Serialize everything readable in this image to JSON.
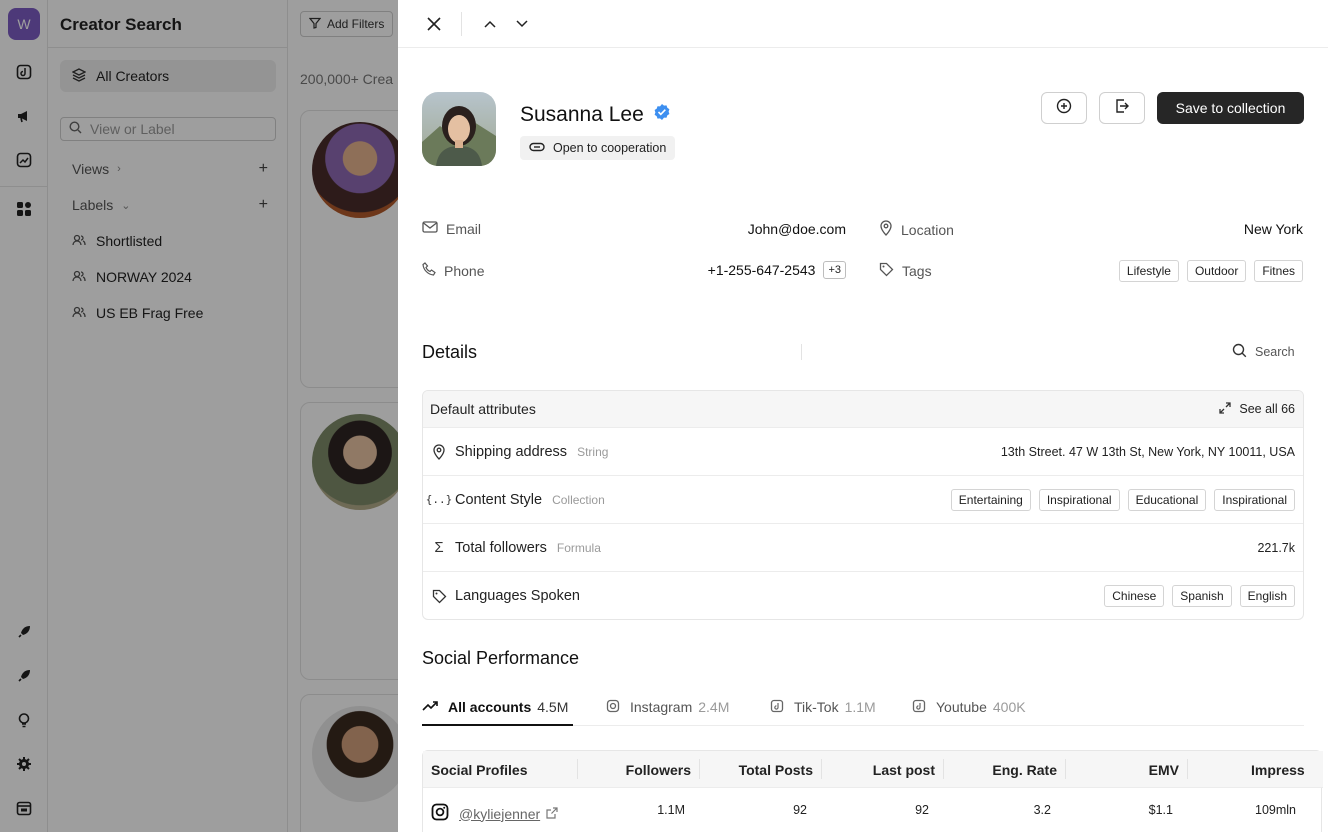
{
  "app": {
    "workspace_initial": "W",
    "title": "Creator Search",
    "add_filters_label": "Add Filters",
    "result_count": "200,000+ Crea"
  },
  "sidebar": {
    "all_creators": "All Creators",
    "search_placeholder": "View or Label",
    "views_label": "Views",
    "labels_label": "Labels",
    "labels": [
      "Shortlisted",
      "NORWAY 2024",
      "US EB Frag Free"
    ]
  },
  "profile": {
    "name": "Susanna Lee",
    "status": "Open to cooperation",
    "save_label": "Save to collection",
    "email_label": "Email",
    "email": "John@doe.com",
    "phone_label": "Phone",
    "phone": "+1-255-647-2543",
    "phone_extra": "+3",
    "location_label": "Location",
    "location": "New York",
    "tags_label": "Tags",
    "tags": [
      "Lifestyle",
      "Outdoor",
      "Fitnes"
    ]
  },
  "details": {
    "title": "Details",
    "search_label": "Search",
    "box_title": "Default attributes",
    "see_all": "See all 66",
    "rows": [
      {
        "name": "Shipping address",
        "type": "String",
        "value": "13th Street. 47 W 13th St, New York, NY 10011, USA"
      },
      {
        "name": "Content Style",
        "type": "Collection",
        "chips": [
          "Entertaining",
          "Inspirational",
          "Educational",
          "Inspirational"
        ]
      },
      {
        "name": "Total followers",
        "type": "Formula",
        "value": "221.7k"
      },
      {
        "name": "Languages Spoken",
        "type": "",
        "chips": [
          "Chinese",
          "Spanish",
          "English"
        ]
      }
    ]
  },
  "social": {
    "title": "Social Performance",
    "tabs": [
      {
        "label": "All accounts",
        "count": "4.5M"
      },
      {
        "label": "Instagram",
        "count": "2.4M"
      },
      {
        "label": "Tik-Tok",
        "count": "1.1M"
      },
      {
        "label": "Youtube",
        "count": "400K"
      }
    ],
    "columns": [
      "Social Profiles",
      "Followers",
      "Total Posts",
      "Last post",
      "Eng. Rate",
      "EMV",
      "Impress"
    ],
    "row": {
      "handle": "@kyliejenner",
      "followers": "1.1M",
      "total_posts": "92",
      "last_post": "92",
      "eng_rate": "3.2",
      "emv": "$1.1",
      "impressions": "109mln"
    }
  }
}
